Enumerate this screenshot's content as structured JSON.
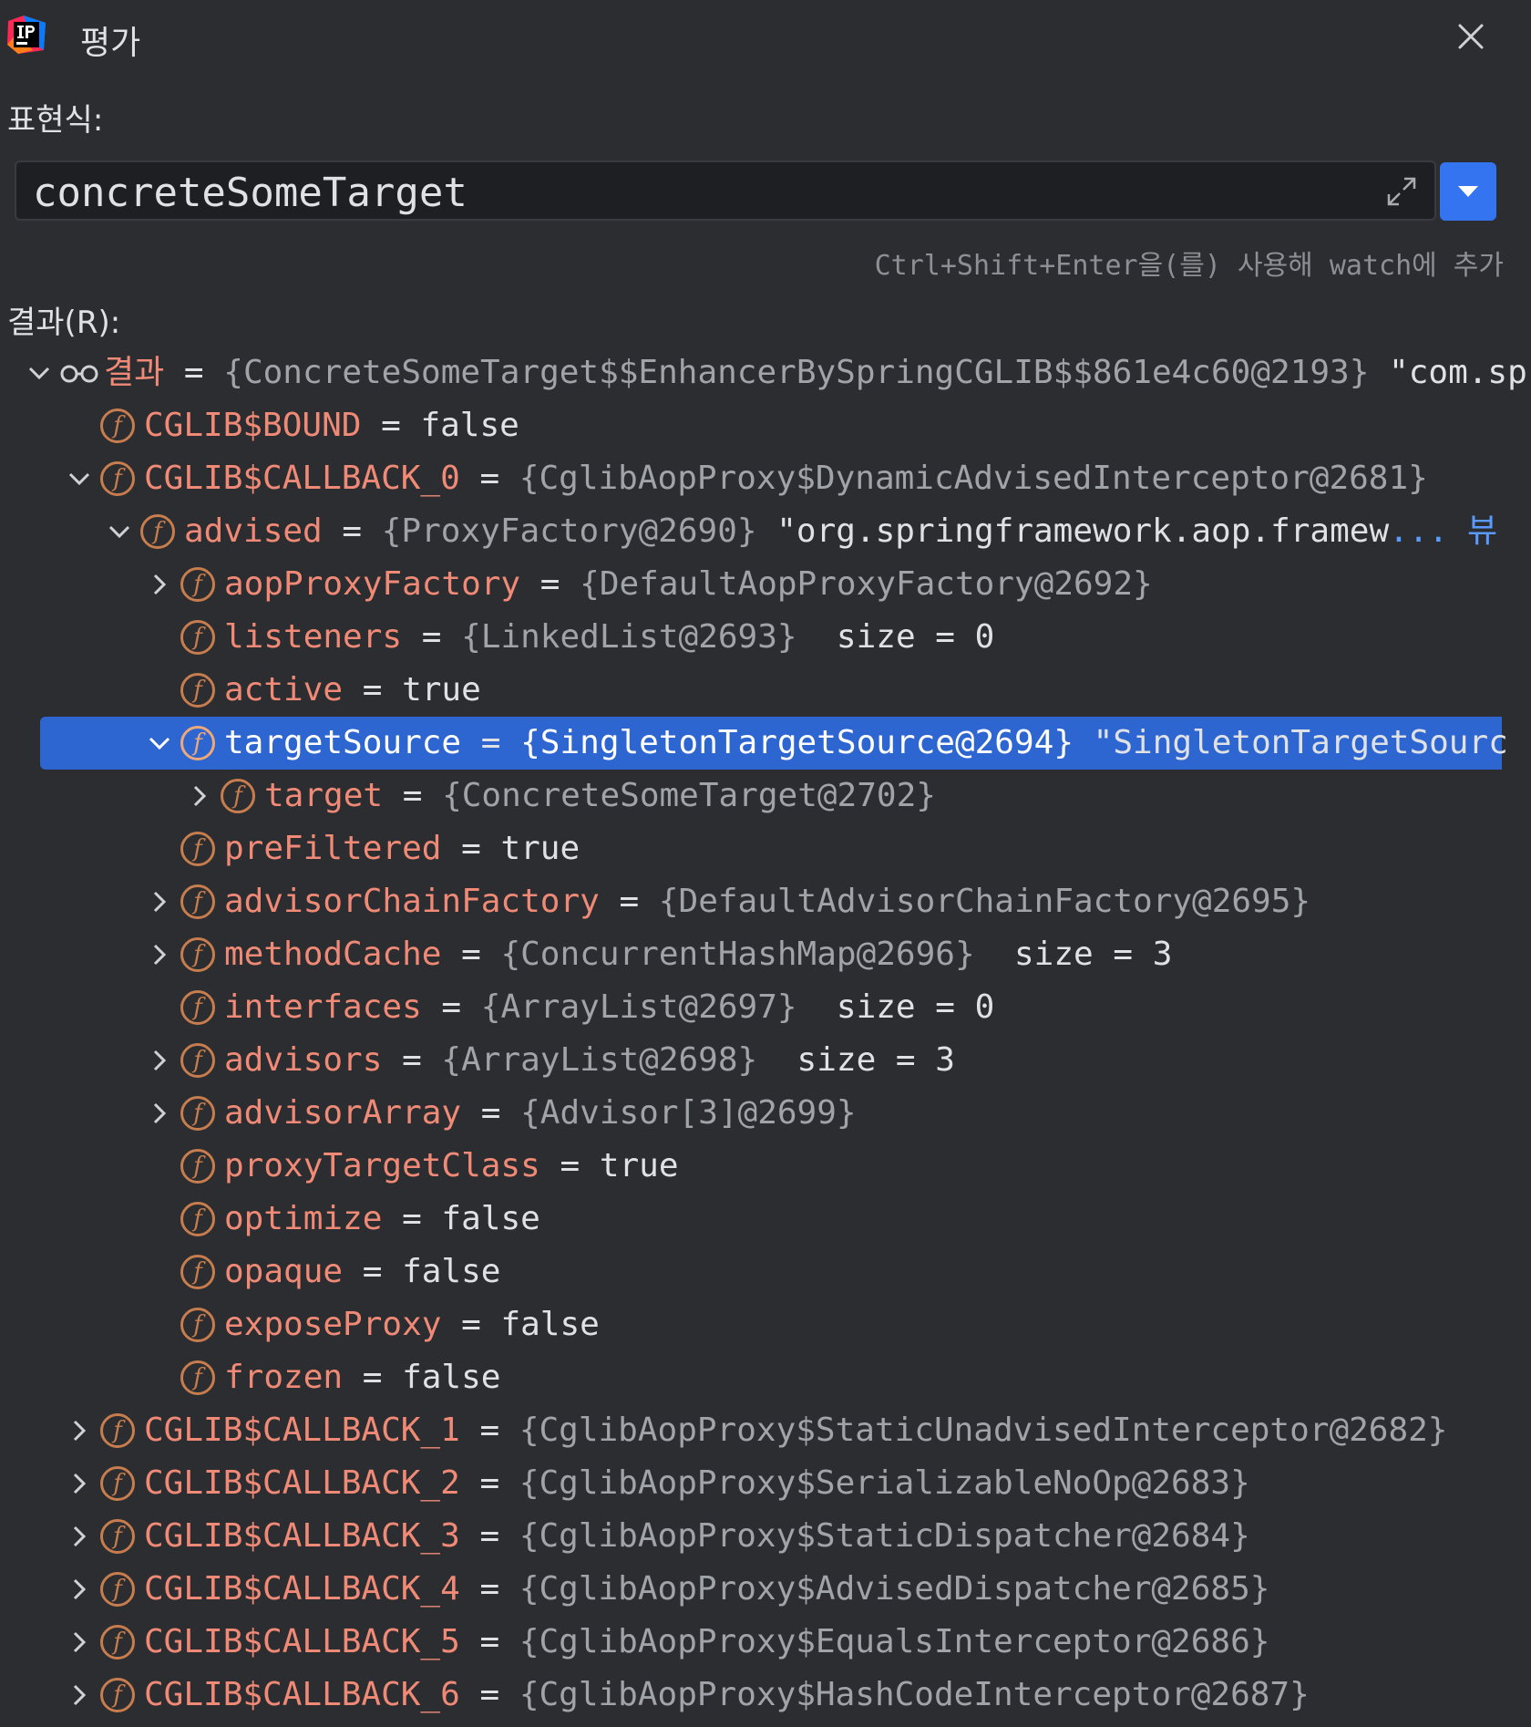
{
  "window": {
    "title": "평가",
    "close_icon": "close-icon",
    "app_icon": "intellij-logo-icon"
  },
  "expression": {
    "label": "표현식:",
    "value": "concreteSomeTarget",
    "hint": "Ctrl+Shift+Enter을(를) 사용해 watch에 추가"
  },
  "result": {
    "label": "결과(R):",
    "rows": [
      {
        "indent": 0,
        "chevron": "down",
        "icon": "watch",
        "name": "결과",
        "eq": " = ",
        "obj": "{ConcreteSomeTarget$$EnhancerBySpringCGLIB$$861e4c60@2193}",
        "val": " \"com.spri"
      },
      {
        "indent": 1,
        "chevron": "none",
        "icon": "field",
        "name": "CGLIB$BOUND",
        "eq": " = ",
        "obj": "",
        "val": "false"
      },
      {
        "indent": 1,
        "chevron": "down",
        "icon": "field",
        "name": "CGLIB$CALLBACK_0",
        "eq": " = ",
        "obj": "{CglibAopProxy$DynamicAdvisedInterceptor@2681}",
        "val": ""
      },
      {
        "indent": 2,
        "chevron": "down",
        "icon": "field",
        "name": "advised",
        "eq": " = ",
        "obj": "{ProxyFactory@2690}",
        "val": " \"org.springframework.aop.framew",
        "ellipsis": "...",
        "link": "뷰"
      },
      {
        "indent": 3,
        "chevron": "right",
        "icon": "field",
        "name": "aopProxyFactory",
        "eq": " = ",
        "obj": "{DefaultAopProxyFactory@2692}",
        "val": ""
      },
      {
        "indent": 3,
        "chevron": "none",
        "icon": "field",
        "name": "listeners",
        "eq": " = ",
        "obj": "{LinkedList@2693}",
        "val": "  size = 0"
      },
      {
        "indent": 3,
        "chevron": "none",
        "icon": "field",
        "name": "active",
        "eq": " = ",
        "obj": "",
        "val": "true"
      },
      {
        "indent": 3,
        "chevron": "down",
        "icon": "field",
        "name": "targetSource",
        "eq": " = ",
        "obj": "{SingletonTargetSource@2694}",
        "val": " \"SingletonTargetSourc",
        "selected": true
      },
      {
        "indent": 4,
        "chevron": "right",
        "icon": "field",
        "name": "target",
        "eq": " = ",
        "obj": "{ConcreteSomeTarget@2702}",
        "val": ""
      },
      {
        "indent": 3,
        "chevron": "none",
        "icon": "field",
        "name": "preFiltered",
        "eq": " = ",
        "obj": "",
        "val": "true"
      },
      {
        "indent": 3,
        "chevron": "right",
        "icon": "field",
        "name": "advisorChainFactory",
        "eq": " = ",
        "obj": "{DefaultAdvisorChainFactory@2695}",
        "val": ""
      },
      {
        "indent": 3,
        "chevron": "right",
        "icon": "field",
        "name": "methodCache",
        "eq": " = ",
        "obj": "{ConcurrentHashMap@2696}",
        "val": "  size = 3"
      },
      {
        "indent": 3,
        "chevron": "none",
        "icon": "field",
        "name": "interfaces",
        "eq": " = ",
        "obj": "{ArrayList@2697}",
        "val": "  size = 0"
      },
      {
        "indent": 3,
        "chevron": "right",
        "icon": "field",
        "name": "advisors",
        "eq": " = ",
        "obj": "{ArrayList@2698}",
        "val": "  size = 3"
      },
      {
        "indent": 3,
        "chevron": "right",
        "icon": "field",
        "name": "advisorArray",
        "eq": " = ",
        "obj": "{Advisor[3]@2699}",
        "val": ""
      },
      {
        "indent": 3,
        "chevron": "none",
        "icon": "field",
        "name": "proxyTargetClass",
        "eq": " = ",
        "obj": "",
        "val": "true"
      },
      {
        "indent": 3,
        "chevron": "none",
        "icon": "field",
        "name": "optimize",
        "eq": " = ",
        "obj": "",
        "val": "false"
      },
      {
        "indent": 3,
        "chevron": "none",
        "icon": "field",
        "name": "opaque",
        "eq": " = ",
        "obj": "",
        "val": "false"
      },
      {
        "indent": 3,
        "chevron": "none",
        "icon": "field",
        "name": "exposeProxy",
        "eq": " = ",
        "obj": "",
        "val": "false"
      },
      {
        "indent": 3,
        "chevron": "none",
        "icon": "field",
        "name": "frozen",
        "eq": " = ",
        "obj": "",
        "val": "false"
      },
      {
        "indent": 1,
        "chevron": "right",
        "icon": "field",
        "name": "CGLIB$CALLBACK_1",
        "eq": " = ",
        "obj": "{CglibAopProxy$StaticUnadvisedInterceptor@2682}",
        "val": ""
      },
      {
        "indent": 1,
        "chevron": "right",
        "icon": "field",
        "name": "CGLIB$CALLBACK_2",
        "eq": " = ",
        "obj": "{CglibAopProxy$SerializableNoOp@2683}",
        "val": ""
      },
      {
        "indent": 1,
        "chevron": "right",
        "icon": "field",
        "name": "CGLIB$CALLBACK_3",
        "eq": " = ",
        "obj": "{CglibAopProxy$StaticDispatcher@2684}",
        "val": ""
      },
      {
        "indent": 1,
        "chevron": "right",
        "icon": "field",
        "name": "CGLIB$CALLBACK_4",
        "eq": " = ",
        "obj": "{CglibAopProxy$AdvisedDispatcher@2685}",
        "val": ""
      },
      {
        "indent": 1,
        "chevron": "right",
        "icon": "field",
        "name": "CGLIB$CALLBACK_5",
        "eq": " = ",
        "obj": "{CglibAopProxy$EqualsInterceptor@2686}",
        "val": ""
      },
      {
        "indent": 1,
        "chevron": "right",
        "icon": "field",
        "name": "CGLIB$CALLBACK_6",
        "eq": " = ",
        "obj": "{CglibAopProxy$HashCodeInterceptor@2687}",
        "val": ""
      }
    ]
  }
}
